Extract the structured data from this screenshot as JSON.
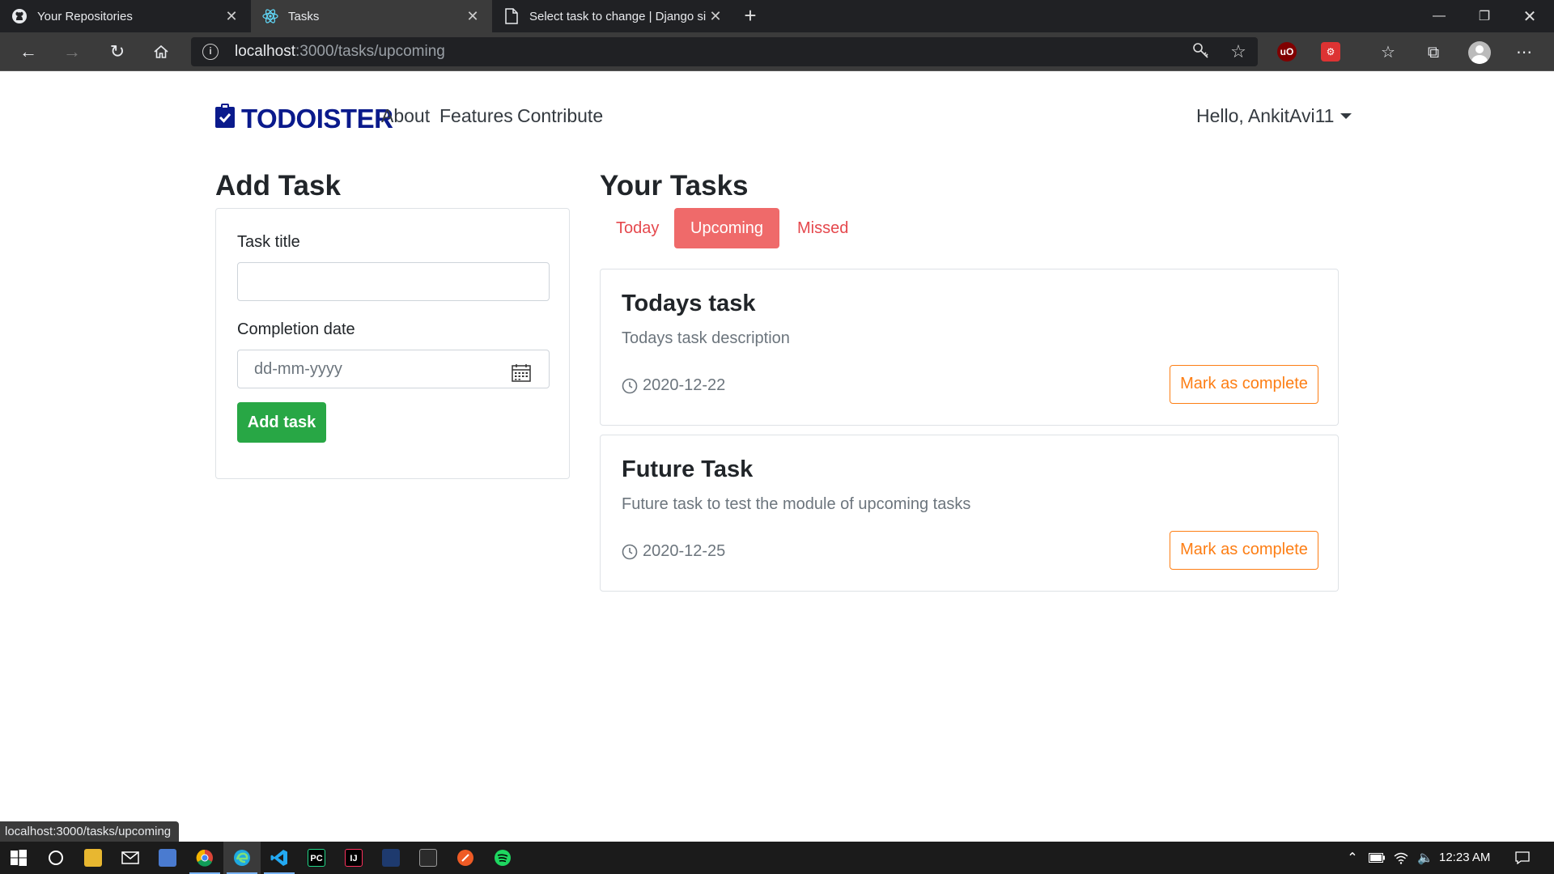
{
  "browser": {
    "tabs": [
      {
        "title": "Your Repositories",
        "icon": "github-icon"
      },
      {
        "title": "Tasks",
        "icon": "react-icon"
      },
      {
        "title": "Select task to change | Django si",
        "icon": "page-icon"
      }
    ],
    "url_host": "localhost",
    "url_path": ":3000/tasks/upcoming",
    "status_url": "localhost:3000/tasks/upcoming"
  },
  "nav": {
    "brand": "TODOISTER",
    "links": [
      "About",
      "Features",
      "Contribute"
    ],
    "user": "Hello, AnkitAvi11"
  },
  "add_task": {
    "heading": "Add Task",
    "title_label": "Task title",
    "title_value": "",
    "date_label": "Completion date",
    "date_placeholder": "dd-mm-yyyy",
    "submit_label": "Add task"
  },
  "tasks": {
    "heading": "Your Tasks",
    "filters": [
      "Today",
      "Upcoming",
      "Missed"
    ],
    "active_filter": "Upcoming",
    "items": [
      {
        "title": "Todays task",
        "description": "Todays task description",
        "date": "2020-12-22",
        "action": "Mark as complete"
      },
      {
        "title": "Future Task",
        "description": "Future task to test the module of upcoming tasks",
        "date": "2020-12-25",
        "action": "Mark as complete"
      }
    ]
  },
  "taskbar": {
    "time": "12:23 AM"
  },
  "colors": {
    "brand": "#0a1a8c",
    "success": "#28a745",
    "pill_active": "#ef6a6a",
    "pill_text": "#e5484d",
    "warning": "#fd7e14"
  }
}
